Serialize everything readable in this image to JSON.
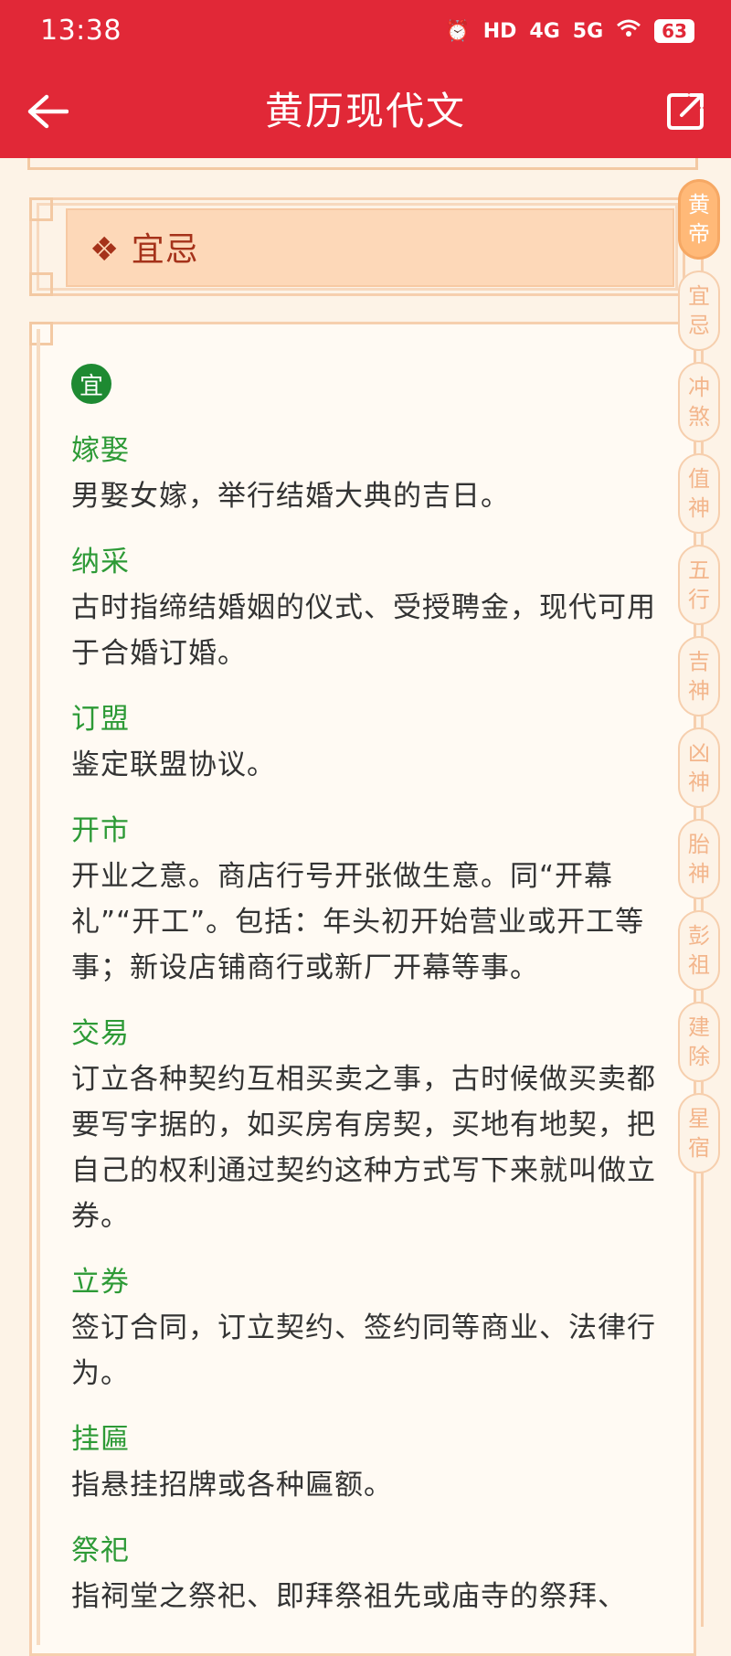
{
  "status_bar": {
    "time": "13:38",
    "hd": "HD",
    "signal_1": "4G",
    "signal_2": "5G",
    "battery": "63"
  },
  "header": {
    "title": "黄历现代文",
    "back_icon": "back-arrow-icon",
    "share_icon": "share-icon",
    "background": "#e12837"
  },
  "section": {
    "title": "❖ 宜忌",
    "badge": "宜"
  },
  "entries": [
    {
      "term": "嫁娶",
      "desc": "男娶女嫁，举行结婚大典的吉日。"
    },
    {
      "term": "纳采",
      "desc": "古时指缔结婚姻的仪式、受授聘金，现代可用于合婚订婚。"
    },
    {
      "term": "订盟",
      "desc": "鉴定联盟协议。"
    },
    {
      "term": "开市",
      "desc": "开业之意。商店行号开张做生意。同“开幕礼”“开工”。包括：年头初开始营业或开工等事；新设店铺商行或新厂开幕等事。"
    },
    {
      "term": "交易",
      "desc": "订立各种契约互相买卖之事，古时候做买卖都要写字据的，如买房有房契，买地有地契，把自己的权利通过契约这种方式写下来就叫做立券。"
    },
    {
      "term": "立券",
      "desc": "签订合同，订立契约、签约同等商业、法律行为。"
    },
    {
      "term": "挂匾",
      "desc": "指悬挂招牌或各种匾额。"
    },
    {
      "term": "祭祀",
      "desc": "指祠堂之祭祀、即拜祭祖先或庙寺的祭拜、"
    }
  ],
  "sidenav": [
    {
      "line1": "黄",
      "line2": "帝",
      "active": true
    },
    {
      "line1": "宜",
      "line2": "忌"
    },
    {
      "line1": "冲",
      "line2": "煞"
    },
    {
      "line1": "值",
      "line2": "神"
    },
    {
      "line1": "五",
      "line2": "行"
    },
    {
      "line1": "吉",
      "line2": "神"
    },
    {
      "line1": "凶",
      "line2": "神"
    },
    {
      "line1": "胎",
      "line2": "神"
    },
    {
      "line1": "彭",
      "line2": "祖"
    },
    {
      "line1": "建",
      "line2": "除"
    },
    {
      "line1": "星",
      "line2": "宿"
    }
  ]
}
